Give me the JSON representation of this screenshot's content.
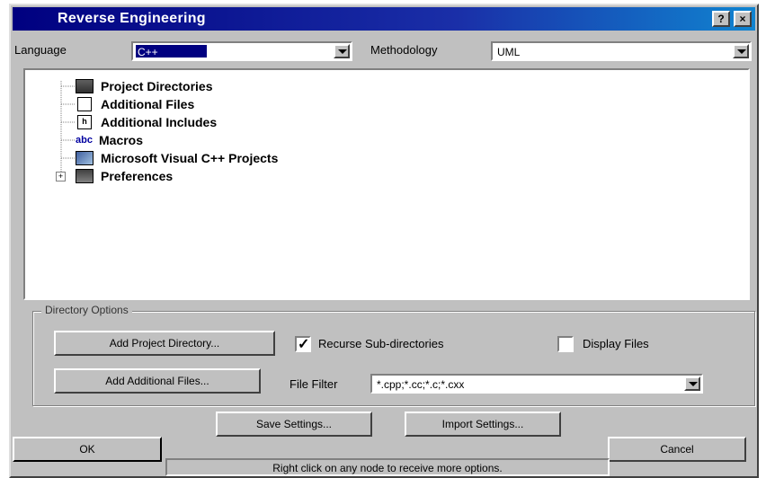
{
  "window": {
    "title": "Reverse Engineering",
    "help_btn": "?",
    "close_btn": "×"
  },
  "language": {
    "label": "Language",
    "value": "C++"
  },
  "methodology": {
    "label": "Methodology",
    "value": "UML"
  },
  "tree": {
    "items": [
      {
        "label": "Project Directories",
        "icon": "folder-icon"
      },
      {
        "label": "Additional Files",
        "icon": "file-icon"
      },
      {
        "label": "Additional Includes",
        "icon": "include-icon"
      },
      {
        "label": "Macros",
        "icon": "macro-icon"
      },
      {
        "label": "Microsoft Visual C++ Projects",
        "icon": "vc-project-icon"
      },
      {
        "label": "Preferences",
        "icon": "preferences-icon"
      }
    ],
    "expander": "+"
  },
  "directory_options": {
    "group_label": "Directory Options",
    "add_project_btn": "Add Project Directory...",
    "add_files_btn": "Add Additional Files...",
    "recurse_label": "Recurse Sub-directories",
    "recurse_checked": true,
    "display_files_label": "Display Files",
    "display_files_checked": false,
    "file_filter_label": "File Filter",
    "file_filter_value": "*.cpp;*.cc;*.c;*.cxx"
  },
  "buttons": {
    "save": "Save Settings...",
    "import": "Import Settings...",
    "ok": "OK",
    "cancel": "Cancel"
  },
  "status": "Right click on any node to receive more options."
}
